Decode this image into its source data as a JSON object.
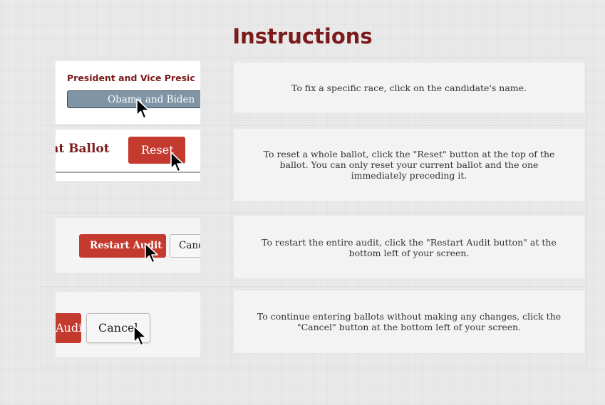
{
  "page_title": "Instructions",
  "rows": [
    {
      "thumb": {
        "race_title": "President and Vice Presic",
        "candidate_button": "Obama and Biden"
      },
      "description": "To fix a specific race, click on the candidate's name."
    },
    {
      "thumb": {
        "ballot_title": "nt Ballot",
        "reset_button": "Reset"
      },
      "description": "To reset a whole ballot, click the \"Reset\" button at the top of the ballot. You can only reset your current ballot and the one immediately preceding it."
    },
    {
      "thumb": {
        "restart_button": "Restart Audit",
        "cancel_button": "Cancel"
      },
      "description": "To restart the entire audit, click the \"Restart Audit button\" at the bottom left of your screen."
    },
    {
      "thumb": {
        "audit_button": "Audit",
        "cancel_button": "Cancel"
      },
      "description": "To continue entering ballots without making any changes, click the \"Cancel\" button at the bottom left of your screen."
    }
  ],
  "colors": {
    "title": "#7b1a1a",
    "button_red": "#c43a2e",
    "candidate_button": "#7f95a6"
  },
  "icons": [
    "mouse-pointer-icon"
  ]
}
